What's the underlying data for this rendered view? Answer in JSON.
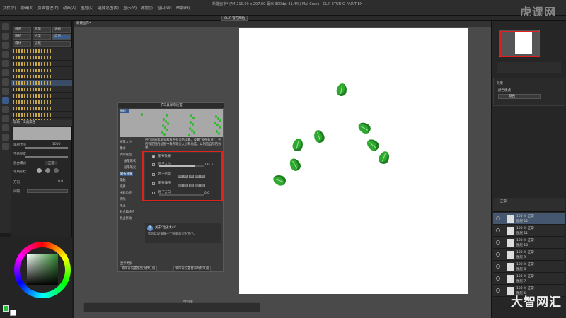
{
  "menu": [
    "文件(F)",
    "编辑(E)",
    "页面管理(P)",
    "动画(A)",
    "图层(L)",
    "选择范围(S)",
    "显示(V)",
    "滤镜(I)",
    "窗口(W)",
    "帮助(H)"
  ],
  "window_title": "新建画布* (A4 210.00 x 297.00 毫米 300dpi 31.4%)   Mai Crack - CLIP STUDIO PAINT EX",
  "clip_button": "CLIP 官方网站",
  "watermark": "虎课网",
  "brand": "大智网汇",
  "subtool": {
    "groups": [
      "线条",
      "毛笔",
      "油画",
      "喷枪",
      "人工",
      "自然",
      "森林",
      "边框"
    ],
    "brushes": [
      "",
      "",
      "",
      "",
      "",
      "",
      "",
      "",
      "",
      "",
      "",
      "",
      "",
      "雪",
      "树",
      "草"
    ],
    "selected_index": 5,
    "title": "辅助 · 工具属性"
  },
  "props": {
    "brush_size_label": "笔刷大小",
    "brush_size_value": "1000",
    "opacity_label": "不透明度",
    "blend_label": "混合模式",
    "blend_value": "正常",
    "brush_shape_label": "笔刷形状",
    "direction_label": "方向",
    "direction_value": "0.0",
    "interval_label": "间隔"
  },
  "canvas_tab": "新建画布*",
  "timeline_label": "时间轴",
  "dialog": {
    "title": "子工具详细设置",
    "preview_label": "图样",
    "info": "进行与画笔笔尖和散布有关的设置。设置“散布效果”，在已有范围的绘图中散布笔尖大小和角度，以制造自然的效果。",
    "categories": [
      "画笔大小",
      "墨水",
      "消除锯齿",
      "画笔形状",
      "画笔笔尖",
      "散布效果",
      "笔触",
      "纸质",
      "水彩边界",
      "消除",
      "修正",
      "起点和终点",
      "防止抖动"
    ],
    "selected_category": 5,
    "settings": [
      {
        "label": "散布效果",
        "checked": true
      },
      {
        "label": "粒子大小",
        "value": "191.5"
      },
      {
        "label": "粒子密度",
        "value": ""
      },
      {
        "label": "散布偏移",
        "value": ""
      },
      {
        "label": "粒子方向",
        "value": "0.0"
      }
    ],
    "hint_title": "关于“粒子大小”",
    "hint_body": "您可以设置每一个画笔笔尖的大小。",
    "show_category": "显示类别",
    "btn_reset_all": "将所有设置恢复为默认值",
    "btn_register_all": "将所有设置登录为默认值"
  },
  "right": {
    "effect_label": "效果",
    "blend_label": "颜色模式",
    "blend_value": "颜色",
    "layer_mode": "正常",
    "layers": [
      {
        "pct": "100 %",
        "mode": "正常",
        "name": "图层 12"
      },
      {
        "pct": "100 %",
        "mode": "正常",
        "name": "图层 11"
      },
      {
        "pct": "100 %",
        "mode": "正常",
        "name": "图层 10"
      },
      {
        "pct": "100 %",
        "mode": "正常",
        "name": "图层 9"
      },
      {
        "pct": "100 %",
        "mode": "正常",
        "name": "图层 8"
      },
      {
        "pct": "100 %",
        "mode": "正常",
        "name": "图层 7"
      },
      {
        "pct": "100 %",
        "mode": "正常",
        "name": "图层 6"
      }
    ]
  },
  "colors": {
    "main": "#22c33a",
    "sub": "#ffffff",
    "highlight": "#d22222",
    "leaf": "#2fa82f"
  }
}
